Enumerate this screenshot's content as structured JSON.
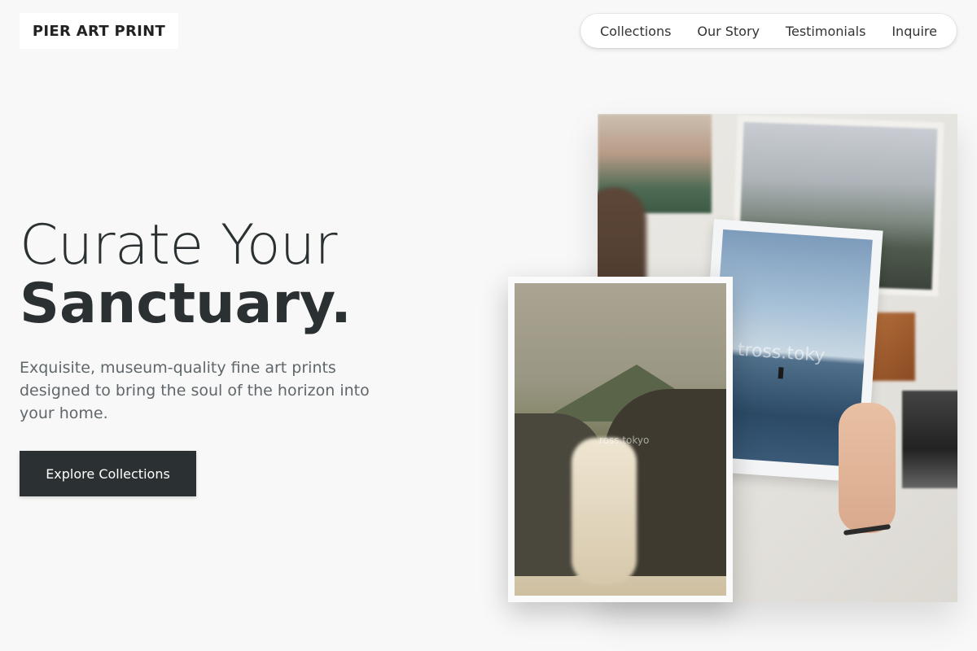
{
  "brand": {
    "logo": "PIER ART PRINT"
  },
  "nav": {
    "items": [
      "Collections",
      "Our Story",
      "Testimonials",
      "Inquire"
    ]
  },
  "hero": {
    "title_line1": "Curate Your",
    "title_line2": "Sanctuary.",
    "subtitle": "Exquisite, museum-quality fine art prints designed to bring the soul of the horizon into your home.",
    "cta_label": "Explore Collections"
  },
  "images": {
    "back_watermark": "tross.toky",
    "front_watermark": "ross.tokyo"
  },
  "colors": {
    "background": "#f8f8f8",
    "text_dark": "#2b3133",
    "text_muted": "#5f676b",
    "button_bg": "#2b3133",
    "button_text": "#ffffff"
  }
}
